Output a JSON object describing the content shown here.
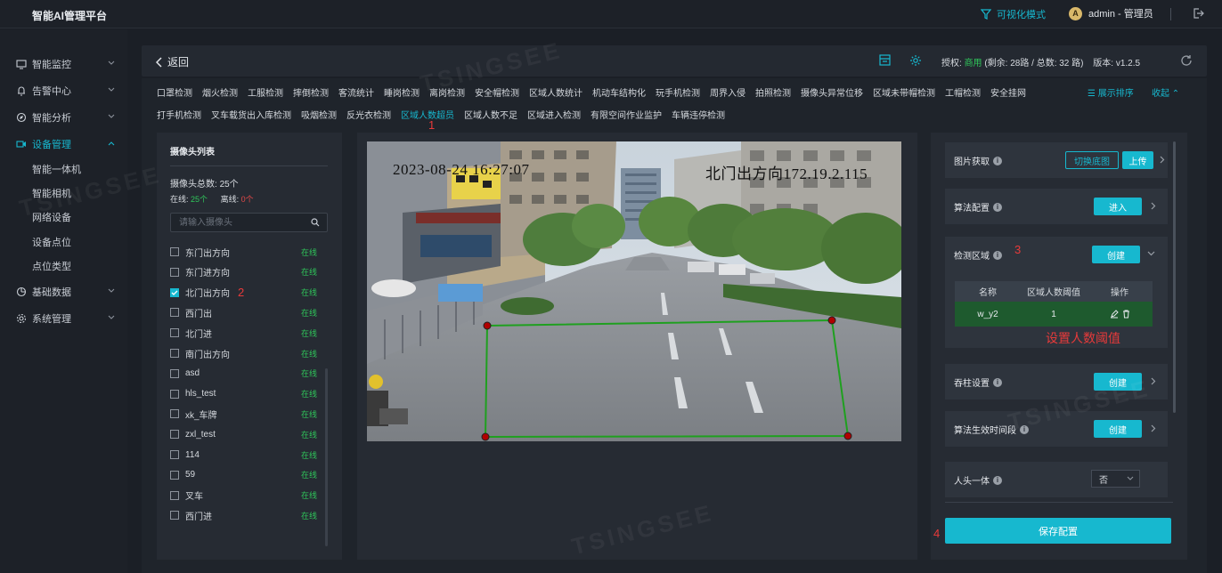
{
  "app": {
    "title": "智能AI管理平台"
  },
  "topbar": {
    "viz_mode": "可视化模式",
    "avatar_letter": "A",
    "user": "admin - 管理员"
  },
  "sidebar": {
    "items": [
      {
        "label": "智能监控"
      },
      {
        "label": "告警中心"
      },
      {
        "label": "智能分析"
      },
      {
        "label": "设备管理"
      },
      {
        "label": "基础数据"
      },
      {
        "label": "系统管理"
      }
    ],
    "sub_items": [
      {
        "label": "智能一体机"
      },
      {
        "label": "智能相机"
      },
      {
        "label": "网络设备"
      },
      {
        "label": "设备点位"
      },
      {
        "label": "点位类型"
      }
    ]
  },
  "header": {
    "back": "返回",
    "license_prefix": "授权:",
    "license_status": "商用",
    "license_detail": "(剩余: 28路 / 总数: 32 路)",
    "version": "版本: v1.2.5"
  },
  "algorithms": {
    "row1": [
      "口罩检测",
      "烟火检测",
      "工服检测",
      "摔倒检测",
      "客流统计",
      "睡岗检测",
      "离岗检测",
      "安全帽检测",
      "区域人数统计",
      "机动车结构化",
      "玩手机检测",
      "周界入侵",
      "拍照检测",
      "摄像头异常位移",
      "区域未带帽检测",
      "工帽检测",
      "安全挂网"
    ],
    "row2": [
      "打手机检测",
      "叉车载货出入库检测",
      "吸烟检测",
      "反光衣检测",
      "区域人数超员",
      "区域人数不足",
      "区域进入检测",
      "有限空间作业监护",
      "车辆违停检测"
    ],
    "show_sort": "展示排序",
    "collapse": "收起"
  },
  "camera_list": {
    "title": "摄像头列表",
    "total_label": "摄像头总数:",
    "total": "25个",
    "online_label": "在线:",
    "online": "25个",
    "offline_label": "离线:",
    "offline": "0个",
    "search_placeholder": "请输入摄像头",
    "status_online": "在线",
    "cameras": [
      {
        "name": "东门出方向",
        "checked": false
      },
      {
        "name": "东门进方向",
        "checked": false
      },
      {
        "name": "北门出方向",
        "checked": true
      },
      {
        "name": "西门出",
        "checked": false
      },
      {
        "name": "北门进",
        "checked": false
      },
      {
        "name": "南门出方向",
        "checked": false
      },
      {
        "name": "asd",
        "checked": false
      },
      {
        "name": "hls_test",
        "checked": false
      },
      {
        "name": "xk_车牌",
        "checked": false
      },
      {
        "name": "zxl_test",
        "checked": false
      },
      {
        "name": "114",
        "checked": false
      },
      {
        "name": "59",
        "checked": false
      },
      {
        "name": "叉车",
        "checked": false
      },
      {
        "name": "西门进",
        "checked": false
      }
    ]
  },
  "preview": {
    "timestamp": "2023-08-24 16:27:07",
    "camera_osd": "北门出方向172.19.2.115"
  },
  "config": {
    "image_fetch": {
      "label": "图片获取",
      "switch_btn": "切换底图",
      "upload_btn": "上传"
    },
    "algo_config": {
      "label": "算法配置",
      "enter_btn": "进入"
    },
    "detect_area": {
      "label": "检测区域",
      "create_btn": "创建",
      "columns": [
        "名称",
        "区域人数阈值",
        "操作"
      ],
      "rows": [
        {
          "name": "w_y2",
          "threshold": "1"
        }
      ]
    },
    "pillar": {
      "label": "吞柱设置",
      "create_btn": "创建"
    },
    "time_period": {
      "label": "算法生效时间段",
      "create_btn": "创建"
    },
    "head_body": {
      "label": "人头一体",
      "value": "否"
    },
    "save_btn": "保存配置"
  },
  "annotations": {
    "n1": "1",
    "n2": "2",
    "n3": "3",
    "n4": "4",
    "threshold_note": "设置人数阈值"
  },
  "colors": {
    "accent": "#17b8cf",
    "online": "#2fc55a",
    "offline": "#e04848",
    "annotation": "#e83a3a",
    "area_line": "#1fa01f"
  }
}
